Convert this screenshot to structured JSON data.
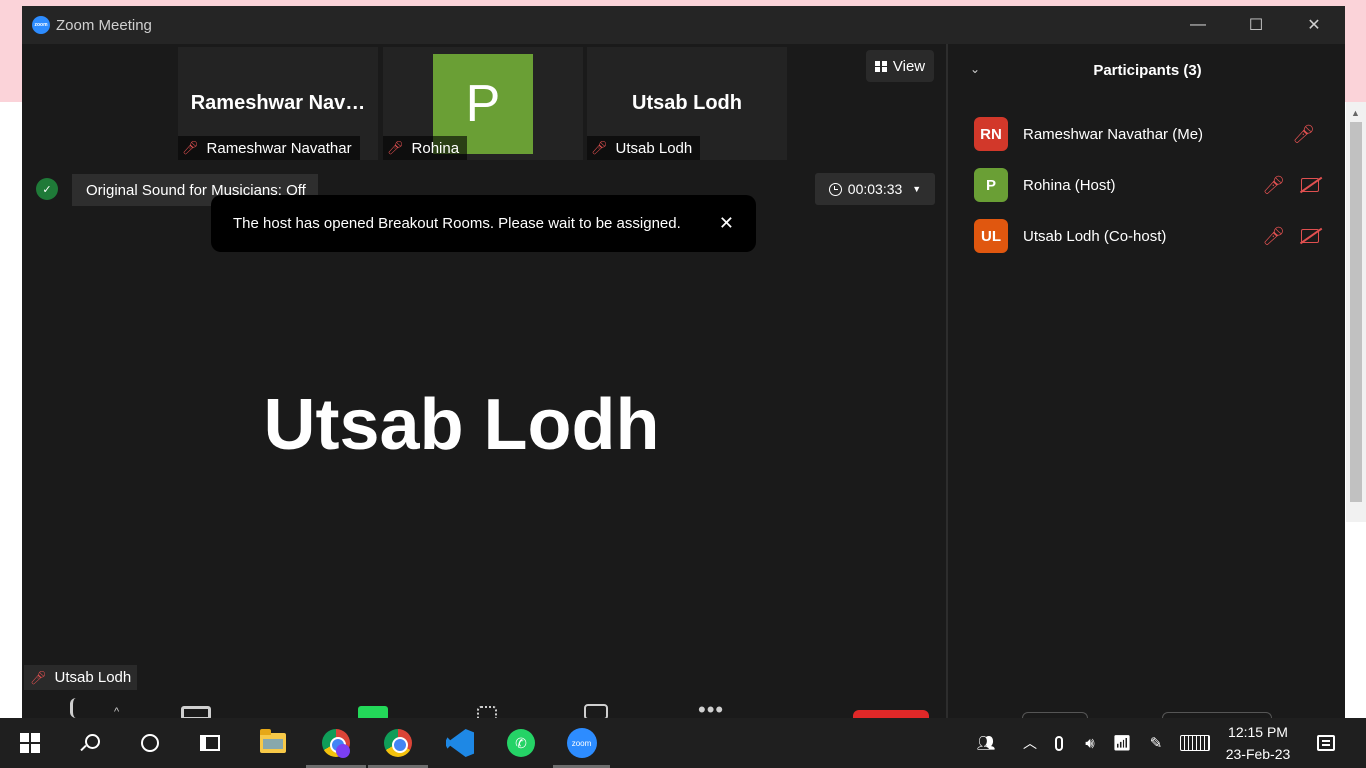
{
  "window": {
    "title": "Zoom Meeting",
    "logo_text": "zoom",
    "minimize": "—",
    "maximize": "☐",
    "close": "✕"
  },
  "thumbnails": [
    {
      "display_name": "Rameshwar  Nav…",
      "label": "Rameshwar Navathar"
    },
    {
      "avatar_letter": "P",
      "label": "Rohina"
    },
    {
      "display_name": "Utsab Lodh",
      "label": "Utsab Lodh"
    }
  ],
  "view_button": "View",
  "original_sound": "Original Sound for Musicians: Off",
  "timer": "00:03:33",
  "toast": {
    "message": "The host has opened Breakout Rooms. Please wait to be assigned.",
    "close": "✕"
  },
  "active_speaker": {
    "name": "Utsab Lodh",
    "label": "Utsab Lodh"
  },
  "participants": {
    "title": "Participants (3)",
    "collapse": "⌄",
    "list": [
      {
        "initials": "RN",
        "name": "Rameshwar Navathar (Me)",
        "color": "#d2382a"
      },
      {
        "initials": "P",
        "name": "Rohina (Host)",
        "color": "#6a9f35"
      },
      {
        "initials": "UL",
        "name": "Utsab Lodh (Co-host)",
        "color": "#e0570f"
      }
    ]
  },
  "taskbar": {
    "zoom_label": "zoom",
    "clock_time": "12:15 PM",
    "clock_date": "23-Feb-23"
  },
  "colors": {
    "accent_zoom": "#2d8cff",
    "muted": "#e05050",
    "end_red": "#e02828",
    "share_green": "#23d959"
  }
}
